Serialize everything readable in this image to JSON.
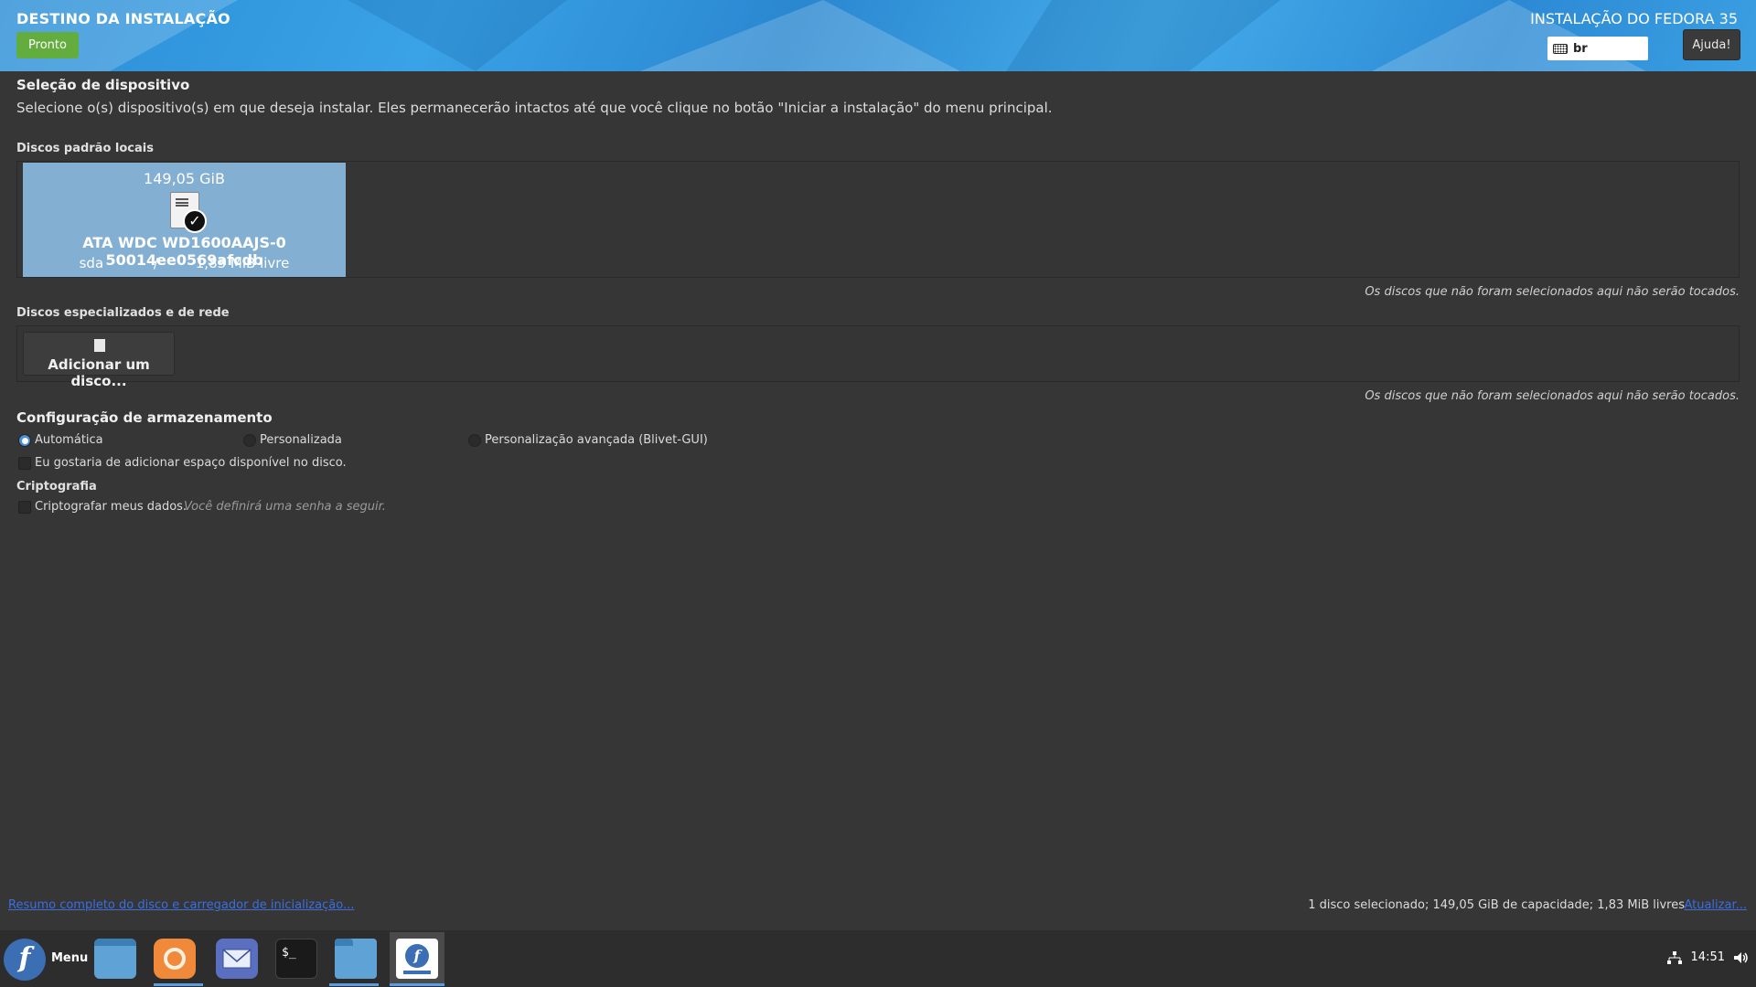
{
  "header": {
    "spoke_title": "DESTINO DA INSTALAÇÃO",
    "ready_label": "Pronto",
    "product_title": "INSTALAÇÃO DO FEDORA 35",
    "keyboard_layout": "br",
    "help_label": "Ajuda!"
  },
  "device_selection": {
    "title": "Seleção de dispositivo",
    "intro": "Selecione o(s) dispositivo(s) em que deseja instalar. Eles permanecerão intactos até que você clique no botão \"Iniciar a instalação\" do menu principal."
  },
  "local_disks": {
    "title": "Discos padrão locais",
    "disks": [
      {
        "size": "149,05 GiB",
        "name": "ATA WDC WD1600AAJS-0 50014ee0569afcdb",
        "device": "sda",
        "separator": "/",
        "free": "1,83 MiB livre",
        "selected": true
      }
    ],
    "note": "Os discos que não foram selecionados aqui não serão tocados."
  },
  "network_disks": {
    "title": "Discos especializados e de rede",
    "add_label": "Adicionar um disco...",
    "note": "Os discos que não foram selecionados aqui não serão tocados."
  },
  "storage_config": {
    "title": "Configuração de armazenamento",
    "options": [
      {
        "label": "Automática",
        "selected": true
      },
      {
        "label": "Personalizada",
        "selected": false
      },
      {
        "label": "Personalização avançada (Blivet-GUI)",
        "selected": false
      }
    ],
    "reclaim_label": "Eu gostaria de adicionar espaço disponível no disco.",
    "reclaim_checked": false
  },
  "encryption": {
    "title": "Criptografia",
    "encrypt_label": "Criptografar meus dados.",
    "encrypt_checked": false,
    "hint": "Você definirá uma senha a seguir."
  },
  "footer": {
    "summary_link": "Resumo completo do disco e carregador de inicialização...",
    "summary": "1 disco selecionado; 149,05 GiB de capacidade; 1,83 MiB livres",
    "refresh_link": "Atualizar..."
  },
  "taskbar": {
    "menu_label": "Menu",
    "apps": [
      "desktop-icon",
      "firefox-icon",
      "mail-icon",
      "terminal-icon",
      "files-icon",
      "anaconda-installer-icon"
    ],
    "clock": "14:51"
  },
  "colors": {
    "header_blue": "#2b8ed6",
    "ready_green": "#62ad3d",
    "selected_disk": "#83afd3",
    "link_blue": "#3b6ee0",
    "background": "#363636"
  }
}
